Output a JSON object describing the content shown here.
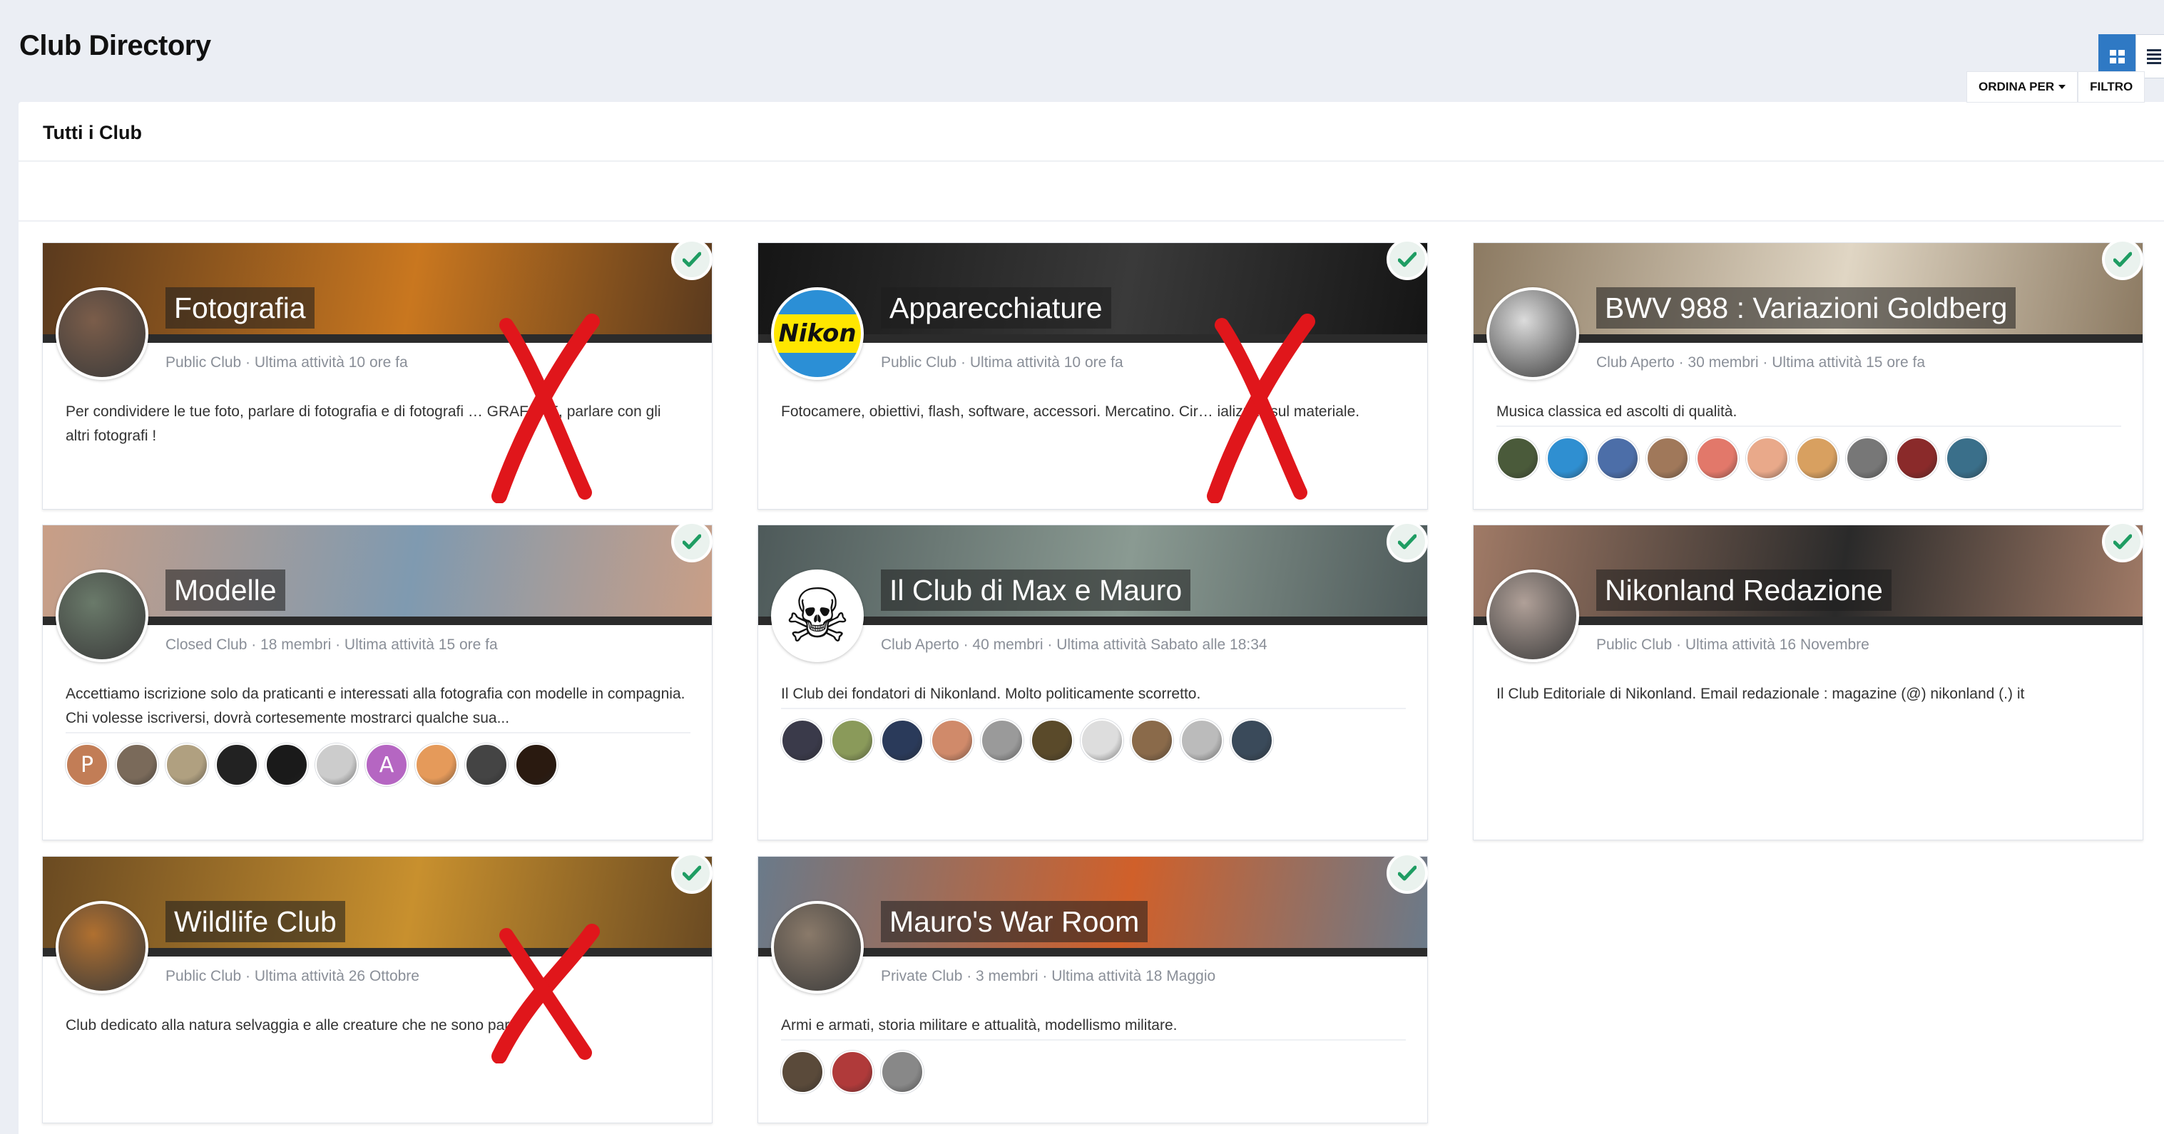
{
  "header": {
    "title": "Club Directory"
  },
  "view_toggle": {
    "grid_label": "grid-view",
    "list_label": "list-view"
  },
  "panel": {
    "title": "Tutti i Club"
  },
  "toolbar": {
    "sort_label": "ORDINA PER",
    "filter_label": "FILTRO"
  },
  "clubs": [
    {
      "name": "Fotografia",
      "meta": "Public Club  ·  Ultima attività 10 ore fa",
      "desc": "Per condividere le tue foto, parlare di fotografia e di fotografi … GRAFARE, parlare con gli altri fotografi !",
      "banner": "#5a3a1e",
      "banner2": "#c9771f",
      "avatar": "#7b5d4a",
      "members": [],
      "crossed": true
    },
    {
      "name": "Apparecchiature",
      "meta": "Public Club  ·  Ultima attività 10 ore fa",
      "desc": "Fotocamere, obiettivi, flash, software, accessori. Mercatino. Cir… ializzati sul materiale.",
      "banner": "#151515",
      "banner2": "#3a3a3a",
      "avatar": "#fff",
      "logo_text": "Nikon",
      "members": [],
      "crossed": true
    },
    {
      "name": "BWV 988 : Variazioni Goldberg",
      "meta": "Club Aperto  ·  30 membri  ·  Ultima attività 15 ore fa",
      "desc": "Musica classica ed ascolti di qualità.",
      "banner": "#8c7a62",
      "banner2": "#e0d6c4",
      "avatar": "#dcdcdc",
      "members": [
        {
          "initial": "",
          "color": "#4a5a3a"
        },
        {
          "initial": "",
          "color": "#2f8fd1"
        },
        {
          "initial": "",
          "color": "#4c6ea8"
        },
        {
          "initial": "",
          "color": "#a0785a"
        },
        {
          "initial": "",
          "color": "#e2786a"
        },
        {
          "initial": "",
          "color": "#e9a98a"
        },
        {
          "initial": "",
          "color": "#d8a060"
        },
        {
          "initial": "",
          "color": "#777777"
        },
        {
          "initial": "",
          "color": "#8a2a2a"
        },
        {
          "initial": "",
          "color": "#3a6f8a"
        }
      ],
      "crossed": false
    },
    {
      "name": "Modelle",
      "meta": "Closed Club  ·  18 membri  ·  Ultima attività 15 ore fa",
      "desc": "Accettiamo iscrizione solo da praticanti e interessati alla fotografia con modelle in compagnia. Chi volesse iscriversi, dovrà cortesemente mostrarci qualche sua...",
      "banner": "#c99e86",
      "banner2": "#7f9ab0",
      "avatar": "#6a7a6a",
      "members": [
        {
          "initial": "P",
          "color": "#c27d56"
        },
        {
          "initial": "",
          "color": "#7a6a5a"
        },
        {
          "initial": "",
          "color": "#b0a080"
        },
        {
          "initial": "",
          "color": "#222222"
        },
        {
          "initial": "",
          "color": "#1a1a1a"
        },
        {
          "initial": "",
          "color": "#cccccc"
        },
        {
          "initial": "A",
          "color": "#b566c2"
        },
        {
          "initial": "",
          "color": "#e59a5a"
        },
        {
          "initial": "",
          "color": "#444444"
        },
        {
          "initial": "",
          "color": "#2a1a10"
        }
      ],
      "crossed": false
    },
    {
      "name": "Il Club di Max e Mauro",
      "meta": "Club Aperto  ·  40 membri  ·  Ultima attività Sabato alle 18:34",
      "desc": "Il Club dei fondatori di Nikonland. Molto politicamente scorretto.",
      "banner": "#4e5a5a",
      "banner2": "#8a9a92",
      "avatar": "#fff",
      "skull": "☠",
      "members": [
        {
          "initial": "",
          "color": "#3a3a4a"
        },
        {
          "initial": "",
          "color": "#8a9a5a"
        },
        {
          "initial": "",
          "color": "#2a3a5a"
        },
        {
          "initial": "",
          "color": "#d08a6a"
        },
        {
          "initial": "",
          "color": "#9a9a9a"
        },
        {
          "initial": "",
          "color": "#5a4a2a"
        },
        {
          "initial": "",
          "color": "#dddddd"
        },
        {
          "initial": "",
          "color": "#8a6a4a"
        },
        {
          "initial": "",
          "color": "#bbbbbb"
        },
        {
          "initial": "",
          "color": "#3a4a5a"
        }
      ],
      "crossed": false
    },
    {
      "name": "Nikonland Redazione",
      "meta": "Public Club  ·  Ultima attività 16 Novembre",
      "desc": "Il Club Editoriale di Nikonland. Email redazionale : magazine (@) nikonland (.) it",
      "banner": "#a07a66",
      "banner2": "#2a2a2a",
      "avatar": "#b0a098",
      "members": [],
      "crossed": false
    },
    {
      "name": "Wildlife Club",
      "meta": "Public Club  ·  Ultima attività 26 Ottobre",
      "desc": "Club dedicato alla natura selvaggia e alle creature che ne sono parte",
      "banner": "#6a4a22",
      "banner2": "#c8902e",
      "avatar": "#b07030",
      "members": [],
      "crossed": true
    },
    {
      "name": "Mauro's War Room",
      "meta": "Private Club  ·  3 membri  ·  Ultima attività 18 Maggio",
      "desc": "Armi e armati, storia militare e attualità, modellismo militare.",
      "banner": "#6a7a8a",
      "banner2": "#d0602a",
      "avatar": "#8a7a6a",
      "members": [
        {
          "initial": "",
          "color": "#5a4a3a"
        },
        {
          "initial": "",
          "color": "#b03a3a"
        },
        {
          "initial": "",
          "color": "#888888"
        }
      ],
      "crossed": false
    }
  ]
}
